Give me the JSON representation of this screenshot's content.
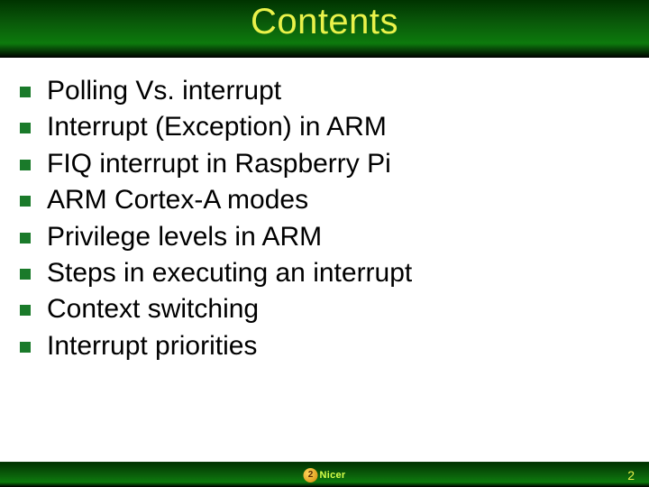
{
  "header": {
    "title": "Contents"
  },
  "items": [
    {
      "text": "Polling Vs. interrupt"
    },
    {
      "text": "Interrupt (Exception) in ARM"
    },
    {
      "text": "FIQ interrupt in Raspberry Pi"
    },
    {
      "text": "ARM Cortex-A modes"
    },
    {
      "text": "Privilege levels in ARM"
    },
    {
      "text": "Steps in executing an interrupt"
    },
    {
      "text": "Context switching"
    },
    {
      "text": "Interrupt priorities"
    }
  ],
  "footer": {
    "logo_text": "Nicer",
    "page_number": "2"
  }
}
